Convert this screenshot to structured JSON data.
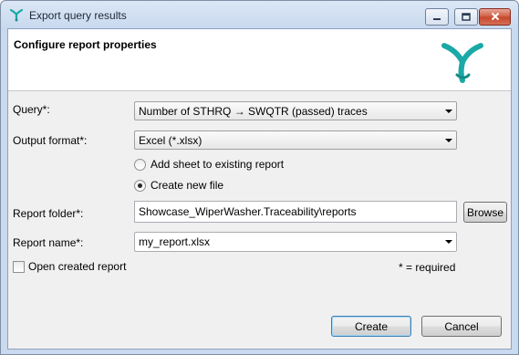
{
  "window": {
    "title": "Export query results",
    "app_icon": "app-logo-icon",
    "controls": [
      "minimize-icon",
      "maximize-icon",
      "close-icon"
    ]
  },
  "banner": {
    "title": "Configure report properties",
    "logo": "app-logo-icon",
    "logo_color": "#1aa9a6"
  },
  "form": {
    "query_label": "Query*:",
    "query_value": "Number of STHRQ → SWQTR (passed) traces",
    "output_format_label": "Output format*:",
    "output_format_value": "Excel (*.xlsx)",
    "radio_add_sheet": "Add sheet to existing report",
    "radio_create_new": "Create new file",
    "selected_radio": "create_new",
    "report_folder_label": "Report folder*:",
    "report_folder_value": "Showcase_WiperWasher.Traceability\\reports",
    "browse_label": "Browse",
    "report_name_label": "Report name*:",
    "report_name_value": "my_report.xlsx",
    "open_report_label": "Open created report",
    "open_report_checked": false,
    "required_note": "* = required"
  },
  "footer": {
    "create_label": "Create",
    "cancel_label": "Cancel"
  }
}
